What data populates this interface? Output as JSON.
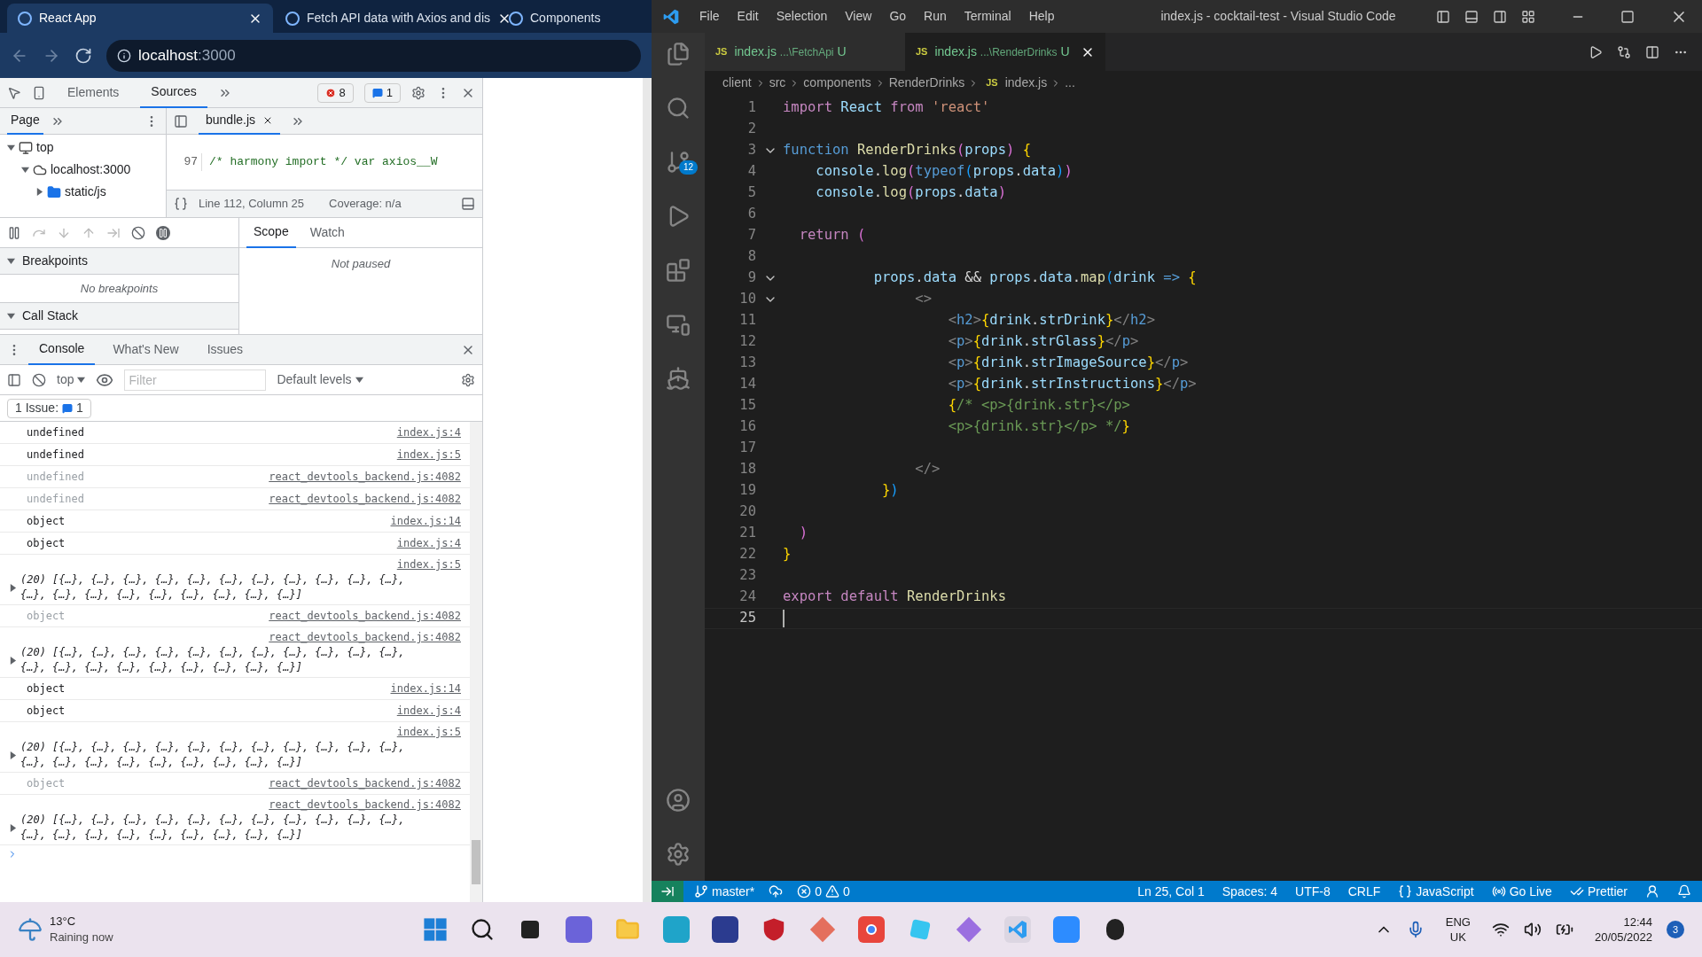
{
  "browser": {
    "tabs": [
      {
        "title": "React App",
        "selected": true
      },
      {
        "title": "Fetch API data with Axios and dis",
        "selected": false
      },
      {
        "title": "Components",
        "selected": false
      }
    ],
    "address": {
      "host": "localhost",
      "port": ":3000"
    },
    "devtools": {
      "tabs": [
        {
          "label": "Elements",
          "selected": false
        },
        {
          "label": "Sources",
          "selected": true
        }
      ],
      "error_count": "8",
      "message_count": "1",
      "navigator": {
        "tab": "Page",
        "tree": [
          {
            "label": "top",
            "kind": "frame",
            "expanded": true,
            "children": [
              {
                "label": "localhost:3000",
                "kind": "cloud",
                "expanded": true,
                "children": [
                  {
                    "label": "static/js",
                    "kind": "folder",
                    "expanded": false
                  }
                ]
              }
            ]
          }
        ]
      },
      "editor": {
        "file_tab": "bundle.js",
        "line_number": "97",
        "line_text": "/* harmony import */ var axios__W",
        "position": "Line 112, Column 25",
        "coverage": "Coverage: n/a"
      },
      "sections": [
        {
          "title": "Breakpoints",
          "expanded": true,
          "empty_text": "No breakpoints"
        },
        {
          "title": "Call Stack",
          "expanded": true
        }
      ],
      "scope_tabs": [
        {
          "label": "Scope",
          "selected": true
        },
        {
          "label": "Watch",
          "selected": false
        }
      ],
      "scope_text": "Not paused",
      "drawer_tabs": [
        {
          "label": "Console",
          "selected": true
        },
        {
          "label": "What's New",
          "selected": false
        },
        {
          "label": "Issues",
          "selected": false
        }
      ],
      "console": {
        "context": "top",
        "filter_placeholder": "Filter",
        "levels": "Default levels",
        "issues_label": "1 Issue:",
        "issues_count": "1",
        "rows": [
          {
            "kind": "value",
            "text": "undefined",
            "source": "index.js:4",
            "muted": false
          },
          {
            "kind": "value",
            "text": "undefined",
            "source": "index.js:5",
            "muted": false
          },
          {
            "kind": "value",
            "text": "undefined",
            "source": "react_devtools_backend.js:4082",
            "muted": true
          },
          {
            "kind": "value",
            "text": "undefined",
            "source": "react_devtools_backend.js:4082",
            "muted": true
          },
          {
            "kind": "value",
            "text": "object",
            "source": "index.js:14",
            "muted": false
          },
          {
            "kind": "value",
            "text": "object",
            "source": "index.js:4",
            "muted": false
          },
          {
            "kind": "array",
            "text": "(20) [{…}, {…}, {…}, {…}, {…}, {…}, {…}, {…}, {…}, {…}, {…}, {…}, {…}, {…}, {…}, {…}, {…}, {…}, {…}, {…}]",
            "source": "index.js:5",
            "muted": false
          },
          {
            "kind": "value",
            "text": "object",
            "source": "react_devtools_backend.js:4082",
            "muted": true
          },
          {
            "kind": "array",
            "text": "(20) [{…}, {…}, {…}, {…}, {…}, {…}, {…}, {…}, {…}, {…}, {…}, {…}, {…}, {…}, {…}, {…}, {…}, {…}, {…}, {…}]",
            "source": "react_devtools_backend.js:4082",
            "muted": false
          },
          {
            "kind": "value",
            "text": "object",
            "source": "index.js:14",
            "muted": false
          },
          {
            "kind": "value",
            "text": "object",
            "source": "index.js:4",
            "muted": false
          },
          {
            "kind": "array",
            "text": "(20) [{…}, {…}, {…}, {…}, {…}, {…}, {…}, {…}, {…}, {…}, {…}, {…}, {…}, {…}, {…}, {…}, {…}, {…}, {…}, {…}]",
            "source": "index.js:5",
            "muted": false
          },
          {
            "kind": "value",
            "text": "object",
            "source": "react_devtools_backend.js:4082",
            "muted": true
          },
          {
            "kind": "array",
            "text": "(20) [{…}, {…}, {…}, {…}, {…}, {…}, {…}, {…}, {…}, {…}, {…}, {…}, {…}, {…}, {…}, {…}, {…}, {…}, {…}, {…}]",
            "source": "react_devtools_backend.js:4082",
            "muted": false
          }
        ]
      }
    }
  },
  "vscode": {
    "menu": [
      "File",
      "Edit",
      "Selection",
      "View",
      "Go",
      "Run",
      "Terminal",
      "Help"
    ],
    "title": "index.js - cocktail-test - Visual Studio Code",
    "source_control_badge": "12",
    "tabs": [
      {
        "icon_label": "JS",
        "name": "index.js",
        "path": "...\\FetchApi",
        "status": "U",
        "selected": false
      },
      {
        "icon_label": "JS",
        "name": "index.js",
        "path": "...\\RenderDrinks",
        "status": "U",
        "selected": true
      }
    ],
    "breadcrumb": [
      {
        "label": "client",
        "kind": "folder"
      },
      {
        "label": "src",
        "kind": "folder"
      },
      {
        "label": "components",
        "kind": "folder"
      },
      {
        "label": "RenderDrinks",
        "kind": "folder"
      },
      {
        "label": "index.js",
        "kind": "js",
        "icon_label": "JS"
      },
      {
        "label": "...",
        "kind": "more"
      }
    ],
    "code": [
      {
        "number": "1",
        "foldable": false,
        "current": false,
        "tokens": [
          {
            "text": "import",
            "kind": "keyword"
          },
          {
            "text": " React",
            "kind": "variable"
          },
          {
            "text": " from",
            "kind": "keyword"
          },
          {
            "text": " 'react'",
            "kind": "string"
          }
        ]
      },
      {
        "number": "2",
        "foldable": false,
        "current": false
      },
      {
        "number": "3",
        "foldable": true,
        "current": false,
        "tokens": [
          {
            "text": "function",
            "kind": "storage"
          },
          {
            "text": " RenderDrinks",
            "kind": "function"
          },
          {
            "text": "(",
            "kind": "bracket2"
          },
          {
            "text": "props",
            "kind": "variable"
          },
          {
            "text": ")",
            "kind": "bracket2"
          },
          {
            "text": " {",
            "kind": "bracket1"
          }
        ]
      },
      {
        "number": "4",
        "foldable": false,
        "current": false,
        "tokens": [
          {
            "text": "    console",
            "kind": "variable"
          },
          {
            "text": ".",
            "kind": "plain"
          },
          {
            "text": "log",
            "kind": "function"
          },
          {
            "text": "(",
            "kind": "bracket2"
          },
          {
            "text": "typeof",
            "kind": "storage"
          },
          {
            "text": "(",
            "kind": "bracket3"
          },
          {
            "text": "props",
            "kind": "variable"
          },
          {
            "text": ".",
            "kind": "plain"
          },
          {
            "text": "data",
            "kind": "variable"
          },
          {
            "text": ")",
            "kind": "bracket3"
          },
          {
            "text": ")",
            "kind": "bracket2"
          }
        ]
      },
      {
        "number": "5",
        "foldable": false,
        "current": false,
        "tokens": [
          {
            "text": "    console",
            "kind": "variable"
          },
          {
            "text": ".",
            "kind": "plain"
          },
          {
            "text": "log",
            "kind": "function"
          },
          {
            "text": "(",
            "kind": "bracket2"
          },
          {
            "text": "props",
            "kind": "variable"
          },
          {
            "text": ".",
            "kind": "plain"
          },
          {
            "text": "data",
            "kind": "variable"
          },
          {
            "text": ")",
            "kind": "bracket2"
          }
        ]
      },
      {
        "number": "6",
        "foldable": false,
        "current": false
      },
      {
        "number": "7",
        "foldable": false,
        "current": false,
        "tokens": [
          {
            "text": "  return",
            "kind": "keyword"
          },
          {
            "text": " (",
            "kind": "bracket2"
          }
        ]
      },
      {
        "number": "8",
        "foldable": false,
        "current": false
      },
      {
        "number": "9",
        "foldable": true,
        "current": false,
        "tokens": [
          {
            "text": "           props",
            "kind": "variable"
          },
          {
            "text": ".",
            "kind": "plain"
          },
          {
            "text": "data",
            "kind": "variable"
          },
          {
            "text": " &&",
            "kind": "plain"
          },
          {
            "text": " props",
            "kind": "variable"
          },
          {
            "text": ".",
            "kind": "plain"
          },
          {
            "text": "data",
            "kind": "variable"
          },
          {
            "text": ".",
            "kind": "plain"
          },
          {
            "text": "map",
            "kind": "function"
          },
          {
            "text": "(",
            "kind": "bracket3"
          },
          {
            "text": "drink",
            "kind": "variable"
          },
          {
            "text": " =>",
            "kind": "storage"
          },
          {
            "text": " {",
            "kind": "bracket1"
          }
        ]
      },
      {
        "number": "10",
        "foldable": true,
        "current": false,
        "tokens": [
          {
            "text": "                <>",
            "kind": "tag"
          }
        ]
      },
      {
        "number": "11",
        "foldable": false,
        "current": false,
        "tokens": [
          {
            "text": "                    <",
            "kind": "tag"
          },
          {
            "text": "h2",
            "kind": "tagname"
          },
          {
            "text": ">",
            "kind": "tag"
          },
          {
            "text": "{",
            "kind": "bracket1"
          },
          {
            "text": "drink",
            "kind": "variable"
          },
          {
            "text": ".",
            "kind": "plain"
          },
          {
            "text": "strDrink",
            "kind": "variable"
          },
          {
            "text": "}",
            "kind": "bracket1"
          },
          {
            "text": "</",
            "kind": "tag"
          },
          {
            "text": "h2",
            "kind": "tagname"
          },
          {
            "text": ">",
            "kind": "tag"
          }
        ]
      },
      {
        "number": "12",
        "foldable": false,
        "current": false,
        "tokens": [
          {
            "text": "                    <",
            "kind": "tag"
          },
          {
            "text": "p",
            "kind": "tagname"
          },
          {
            "text": ">",
            "kind": "tag"
          },
          {
            "text": "{",
            "kind": "bracket1"
          },
          {
            "text": "drink",
            "kind": "variable"
          },
          {
            "text": ".",
            "kind": "plain"
          },
          {
            "text": "strGlass",
            "kind": "variable"
          },
          {
            "text": "}",
            "kind": "bracket1"
          },
          {
            "text": "</",
            "kind": "tag"
          },
          {
            "text": "p",
            "kind": "tagname"
          },
          {
            "text": ">",
            "kind": "tag"
          }
        ]
      },
      {
        "number": "13",
        "foldable": false,
        "current": false,
        "tokens": [
          {
            "text": "                    <",
            "kind": "tag"
          },
          {
            "text": "p",
            "kind": "tagname"
          },
          {
            "text": ">",
            "kind": "tag"
          },
          {
            "text": "{",
            "kind": "bracket1"
          },
          {
            "text": "drink",
            "kind": "variable"
          },
          {
            "text": ".",
            "kind": "plain"
          },
          {
            "text": "strImageSource",
            "kind": "variable"
          },
          {
            "text": "}",
            "kind": "bracket1"
          },
          {
            "text": "</",
            "kind": "tag"
          },
          {
            "text": "p",
            "kind": "tagname"
          },
          {
            "text": ">",
            "kind": "tag"
          }
        ]
      },
      {
        "number": "14",
        "foldable": false,
        "current": false,
        "tokens": [
          {
            "text": "                    <",
            "kind": "tag"
          },
          {
            "text": "p",
            "kind": "tagname"
          },
          {
            "text": ">",
            "kind": "tag"
          },
          {
            "text": "{",
            "kind": "bracket1"
          },
          {
            "text": "drink",
            "kind": "variable"
          },
          {
            "text": ".",
            "kind": "plain"
          },
          {
            "text": "strInstructions",
            "kind": "variable"
          },
          {
            "text": "}",
            "kind": "bracket1"
          },
          {
            "text": "</",
            "kind": "tag"
          },
          {
            "text": "p",
            "kind": "tagname"
          },
          {
            "text": ">",
            "kind": "tag"
          }
        ]
      },
      {
        "number": "15",
        "foldable": false,
        "current": false,
        "tokens": [
          {
            "text": "                    {",
            "kind": "bracket1"
          },
          {
            "text": "/* <p>{drink.str}</p>",
            "kind": "comment"
          }
        ]
      },
      {
        "number": "16",
        "foldable": false,
        "current": false,
        "tokens": [
          {
            "text": "                    <p>{drink.str}</p> */",
            "kind": "comment"
          },
          {
            "text": "}",
            "kind": "bracket1"
          }
        ]
      },
      {
        "number": "17",
        "foldable": false,
        "current": false
      },
      {
        "number": "18",
        "foldable": false,
        "current": false,
        "tokens": [
          {
            "text": "                </>",
            "kind": "tag"
          }
        ]
      },
      {
        "number": "19",
        "foldable": false,
        "current": false,
        "tokens": [
          {
            "text": "            }",
            "kind": "bracket1"
          },
          {
            "text": ")",
            "kind": "bracket3"
          }
        ]
      },
      {
        "number": "20",
        "foldable": false,
        "current": false
      },
      {
        "number": "21",
        "foldable": false,
        "current": false,
        "tokens": [
          {
            "text": "  )",
            "kind": "bracket2"
          }
        ]
      },
      {
        "number": "22",
        "foldable": false,
        "current": false,
        "tokens": [
          {
            "text": "}",
            "kind": "bracket1"
          }
        ]
      },
      {
        "number": "23",
        "foldable": false,
        "current": false
      },
      {
        "number": "24",
        "foldable": false,
        "current": false,
        "tokens": [
          {
            "text": "export",
            "kind": "keyword"
          },
          {
            "text": " default",
            "kind": "keyword"
          },
          {
            "text": " RenderDrinks",
            "kind": "function"
          }
        ]
      },
      {
        "number": "25",
        "foldable": false,
        "current": true
      }
    ],
    "status_bar": {
      "branch": "master*",
      "errors": "0",
      "warnings": "0",
      "position": "Ln 25, Col 1",
      "spaces": "Spaces: 4",
      "encoding": "UTF-8",
      "eol": "CRLF",
      "language": "JavaScript",
      "go_live": "Go Live",
      "prettier": "Prettier"
    }
  },
  "taskbar": {
    "weather": {
      "temperature": "13°C",
      "condition": "Raining now"
    },
    "language": {
      "code": "ENG",
      "region": "UK"
    },
    "time": "12:44",
    "date": "20/05/2022",
    "notifications": "3"
  }
}
